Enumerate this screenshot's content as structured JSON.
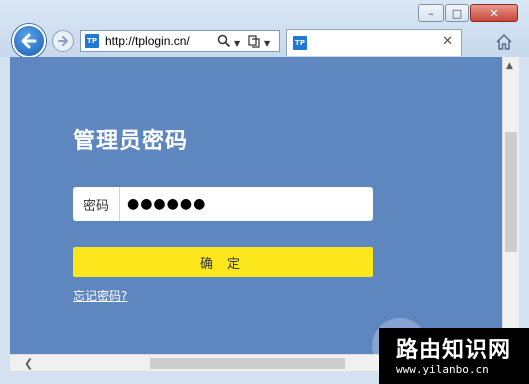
{
  "browser": {
    "address_url": "http://tplogin.cn/",
    "favicon_text": "TP",
    "tab_favicon_text": "TP",
    "tab_title": "",
    "search_icon": "search-icon",
    "refresh_icon": "refresh-icon",
    "close_tab_icon": "close-icon",
    "home_icon": "home-icon",
    "minimize_glyph": "–",
    "maximize_glyph": "□",
    "close_glyph": "✕",
    "back_icon": "back-arrow-icon",
    "forward_icon": "forward-arrow-icon"
  },
  "login": {
    "title": "管理员密码",
    "password_label": "密码",
    "password_value": "●●●●●●",
    "confirm_label": "确定",
    "forgot_link": "忘记密码?"
  },
  "watermark": {
    "main_text": "路由知识网",
    "url_text": "www.yilanbo.cn"
  },
  "colors": {
    "page_background": "#5e86bf",
    "confirm_button": "#fbe71c",
    "text_white": "#ffffff"
  }
}
